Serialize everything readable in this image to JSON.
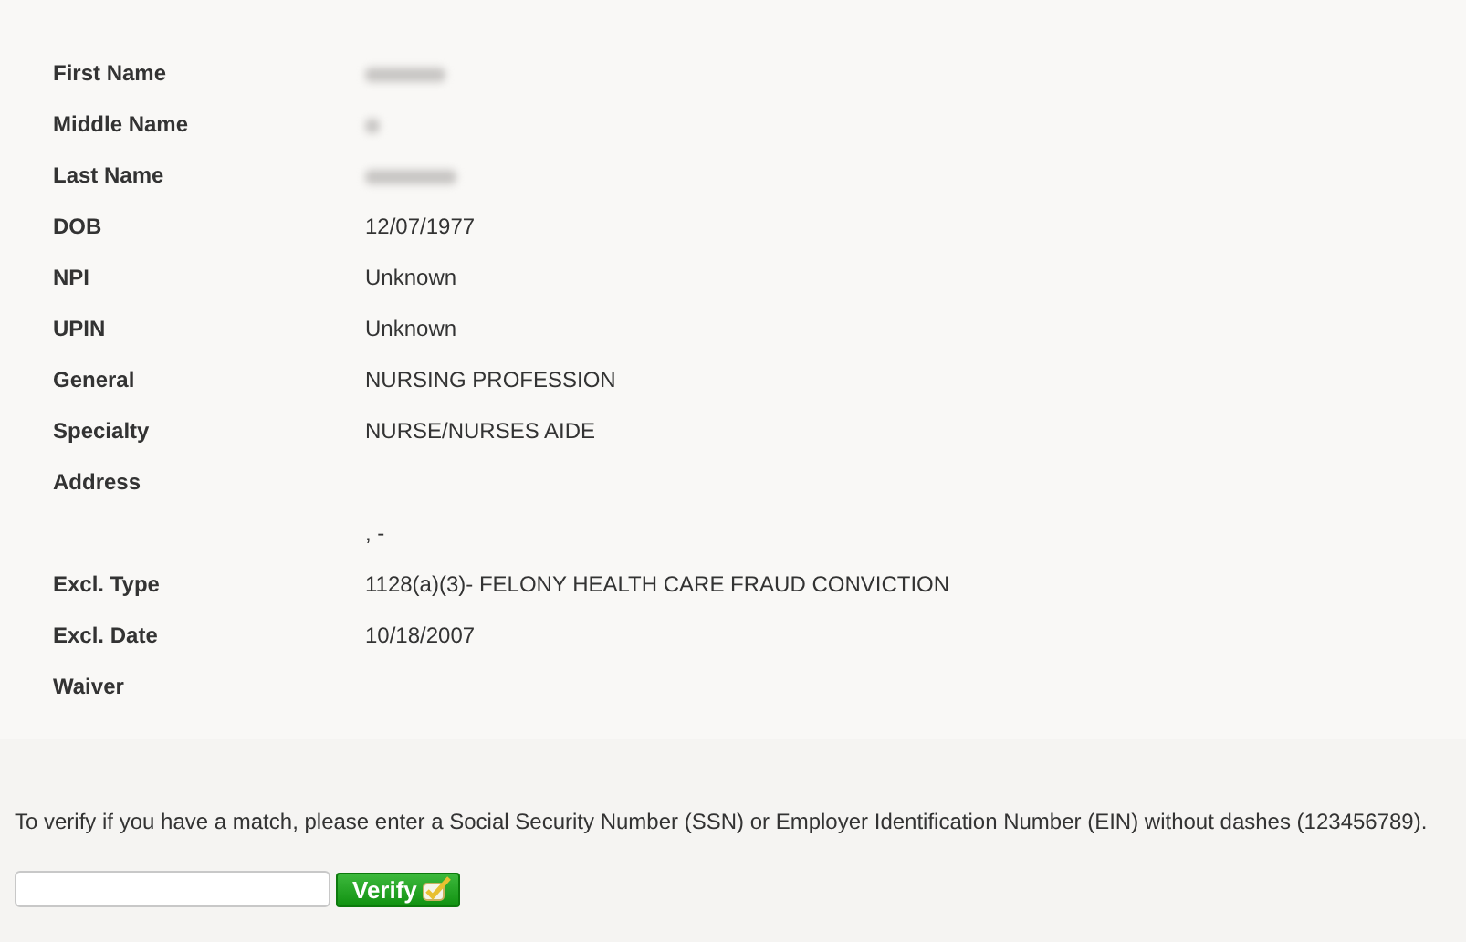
{
  "details": [
    {
      "label": "First Name",
      "redacted": true
    },
    {
      "label": "Middle Name",
      "redacted": true
    },
    {
      "label": "Last Name",
      "redacted": true
    },
    {
      "label": "DOB",
      "value": "12/07/1977",
      "redacted": false
    },
    {
      "label": "NPI",
      "value": "Unknown",
      "redacted": false
    },
    {
      "label": "UPIN",
      "value": "Unknown",
      "redacted": false
    },
    {
      "label": "General",
      "value": "NURSING PROFESSION",
      "redacted": false
    },
    {
      "label": "Specialty",
      "value": "NURSE/NURSES AIDE",
      "redacted": false
    },
    {
      "label": "Address",
      "redacted": false
    },
    {
      "value": ",  -",
      "redacted": false
    },
    {
      "label": "Excl. Type",
      "value": "1128(a)(3)- FELONY HEALTH CARE FRAUD CONVICTION",
      "redacted": false
    },
    {
      "label": "Excl. Date",
      "value": "10/18/2007",
      "redacted": false
    },
    {
      "label": "Waiver",
      "redacted": false
    }
  ],
  "verify": {
    "instructions": "To verify if you have a match, please enter a Social Security Number (SSN) or Employer Identification Number (EIN) without dashes (123456789).",
    "button": "Verify"
  }
}
